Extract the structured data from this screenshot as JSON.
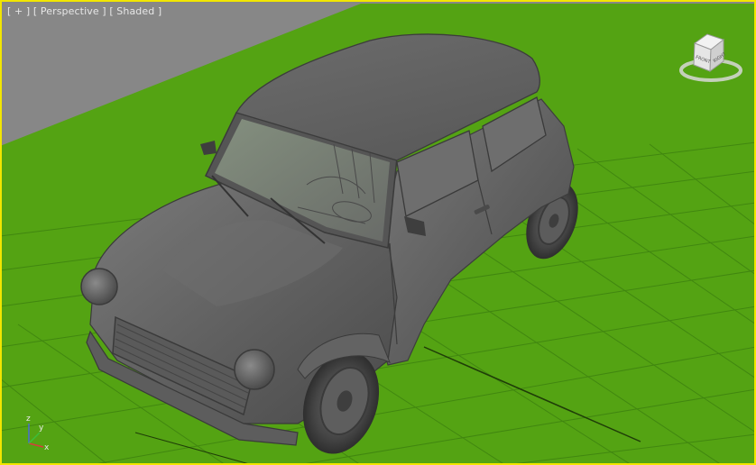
{
  "viewport": {
    "label_plus": "[ + ]",
    "label_view": "[ Perspective ]",
    "label_shading": "[ Shaded ]",
    "active_border_color": "#f2e600",
    "background_color": "#878787",
    "ground_color": "#54a313",
    "grid_line_color": "#3d7d10"
  },
  "viewcube": {
    "face_front": "FRONT",
    "face_right": "RIGHT"
  },
  "axis_tripod": {
    "x": "x",
    "y": "y",
    "z": "z"
  },
  "object": {
    "icon": "car-model-icon"
  }
}
